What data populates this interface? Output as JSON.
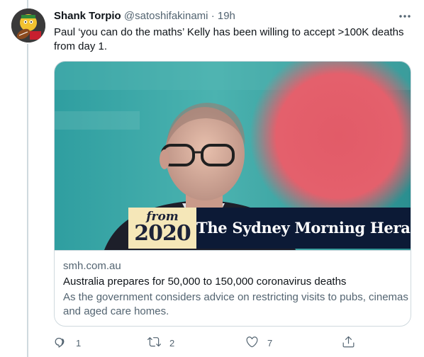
{
  "author": {
    "name": "Shank Torpio",
    "handle": "@satoshifakinami",
    "separator": "·",
    "time": "19h"
  },
  "tweet_text": "Paul ‘you can do the maths’ Kelly has been willing to accept >100K deaths from day 1.",
  "card": {
    "badge_from": "from",
    "badge_year": "2020",
    "masthead": "The Sydney Morning Herald",
    "domain": "smh.com.au",
    "title": "Australia prepares for 50,000 to 150,000 coronavirus deaths",
    "description": "As the government considers advice on restricting visits to pubs, cinemas and aged care homes."
  },
  "actions": {
    "reply_count": "1",
    "retweet_count": "2",
    "like_count": "7"
  },
  "icons": {
    "more": "more-icon",
    "reply": "reply-icon",
    "retweet": "retweet-icon",
    "like": "like-icon",
    "share": "share-icon"
  },
  "colors": {
    "text_primary": "#0f1419",
    "text_secondary": "#536471",
    "border": "#cfd9de",
    "masthead_bg": "#0c1a36",
    "badge_bg": "#f5e7b8"
  }
}
